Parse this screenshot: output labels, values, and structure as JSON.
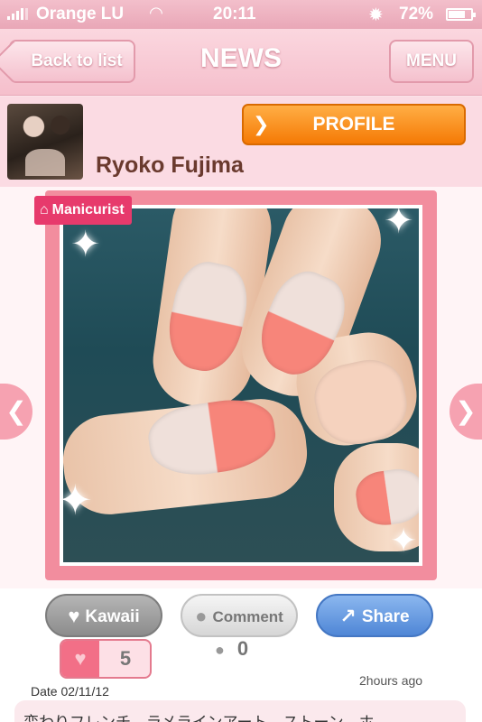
{
  "status_bar": {
    "carrier": "Orange LU",
    "time": "20:11",
    "battery_pct": "72%"
  },
  "nav": {
    "back_label": "Back to list",
    "title": "NEWS",
    "menu_label": "MENU"
  },
  "profile": {
    "name": "Ryoko Fujima",
    "button_label": "PROFILE"
  },
  "photo": {
    "badge": "Manicurist"
  },
  "actions": {
    "kawaii_label": "Kawaii",
    "comment_label": "Comment",
    "share_label": "Share",
    "like_count": "5",
    "comment_count": "0"
  },
  "post": {
    "date": "Date 02/11/12",
    "posted": "2hours ago",
    "description": "変わりフレンチ　ラメラインアート　ストーン　ホ"
  },
  "colors": {
    "accent_pink": "#f28d9e",
    "profile_orange": "#f57a05",
    "share_blue": "#4f86d6"
  }
}
